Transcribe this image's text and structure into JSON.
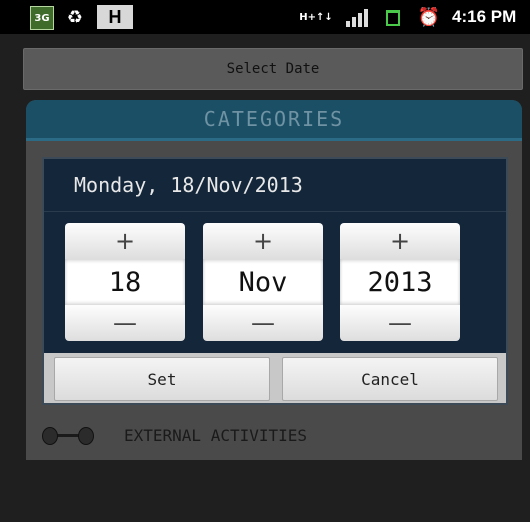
{
  "status_bar": {
    "network_badge": "3G",
    "h_badge": "H",
    "net_type_lines": [
      "H+",
      "↑↓"
    ],
    "time": "4:16 PM",
    "icons": [
      "3g-icon",
      "recycle-icon",
      "h-icon",
      "hplus-icon",
      "signal-icon",
      "battery-icon",
      "alarm-icon"
    ]
  },
  "app": {
    "select_date_label": "Select Date",
    "categories_title": "CATEGORIES",
    "items": [
      {
        "label": "EXTERNAL ACTIVITIES",
        "icon": "dumbbell-icon"
      }
    ]
  },
  "dialog": {
    "title": "Monday, 18/Nov/2013",
    "spinners": [
      {
        "name": "day",
        "value": "18"
      },
      {
        "name": "month",
        "value": "Nov"
      },
      {
        "name": "year",
        "value": "2013"
      }
    ],
    "plus_symbol": "+",
    "minus_symbol": "—",
    "set_label": "Set",
    "cancel_label": "Cancel"
  },
  "colors": {
    "dialog_bg": "#14263a",
    "header_bg": "#1b4f66",
    "battery": "#4ac94a"
  }
}
